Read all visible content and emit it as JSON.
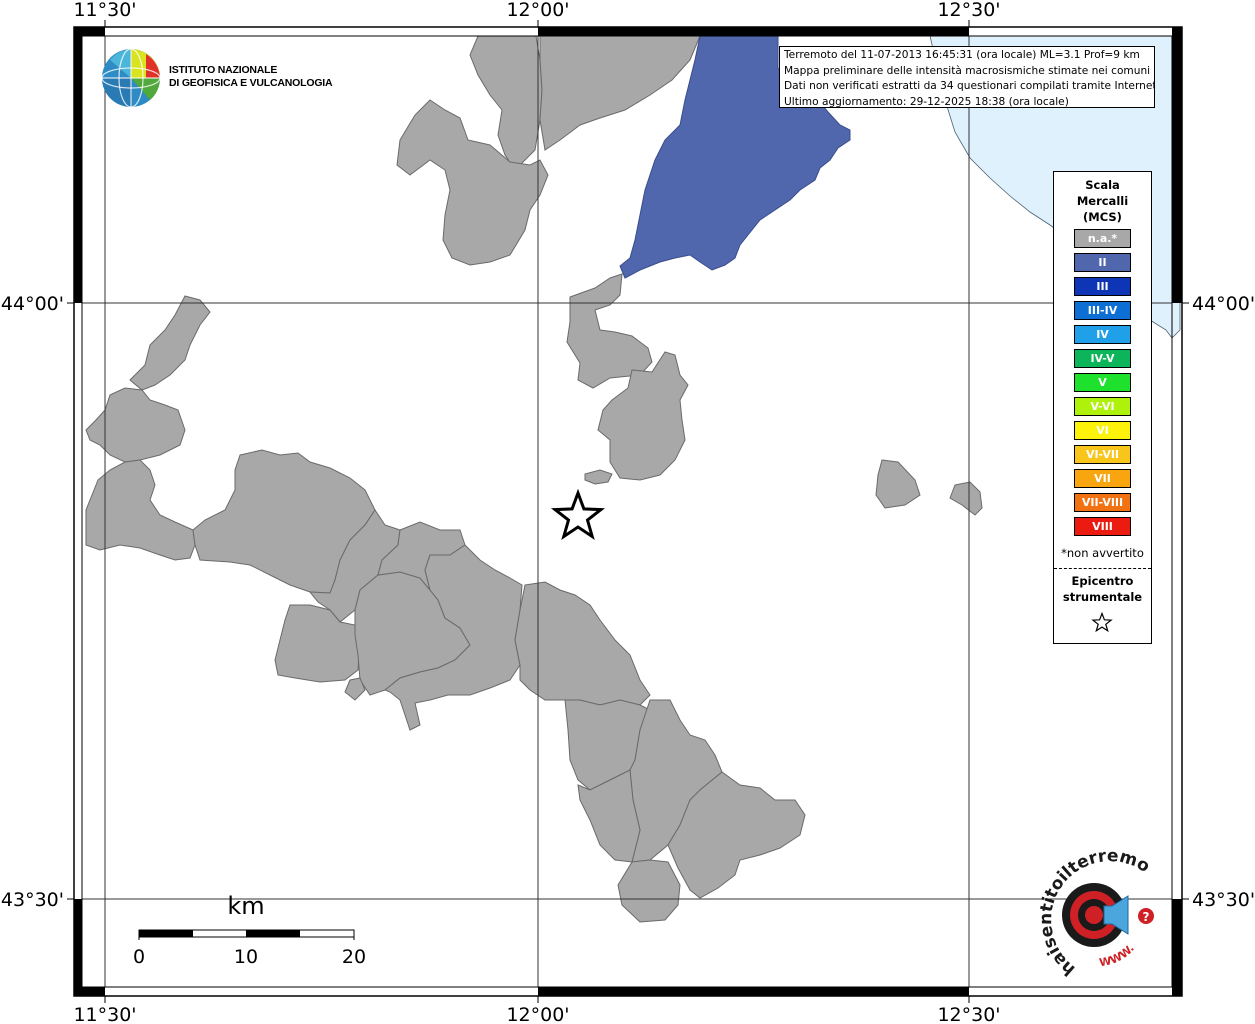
{
  "map": {
    "coord_labels": {
      "top": [
        "11°30'",
        "12°00'",
        "12°30'"
      ],
      "bottom": [
        "11°30'",
        "12°00'",
        "12°30'"
      ],
      "left": [
        "44°00'",
        "43°30'"
      ],
      "right": [
        "44°00'",
        "43°30'"
      ]
    },
    "scale_bar": {
      "unit": "km",
      "ticks": [
        "0",
        "10",
        "20"
      ]
    },
    "colors": {
      "land_na": "#a8a8a8",
      "intensity_II": "#5067ad",
      "sea": "#dff1fc",
      "outline": "#6a6a6a",
      "frame": "#000000"
    }
  },
  "logo": {
    "org_line1": "ISTITUTO NAZIONALE",
    "org_line2": "DI GEOFISICA E VULCANOLOGIA",
    "icon": "ingv-globe-icon"
  },
  "info": {
    "line1": "Terremoto del 11-07-2013 16:45:31 (ora locale) ML=3.1 Prof=9 km",
    "line2": "Mappa preliminare delle intensità macrosismiche stimate nei comuni",
    "line3": "Dati non verificati estratti da 34 questionari compilati tramite Internet.",
    "line4": "Ultimo aggiornamento: 29-12-2025 18:38 (ora locale)"
  },
  "legend": {
    "title_line1": "Scala",
    "title_line2": "Mercalli",
    "title_line3": "(MCS)",
    "items": [
      {
        "label": "n.a.*",
        "color": "#a8a8a8"
      },
      {
        "label": "II",
        "color": "#5067ad"
      },
      {
        "label": "III",
        "color": "#0d35b5"
      },
      {
        "label": "III-IV",
        "color": "#0d6fd3"
      },
      {
        "label": "IV",
        "color": "#1fa0e9"
      },
      {
        "label": "IV-V",
        "color": "#0cb45a"
      },
      {
        "label": "V",
        "color": "#1ee12e"
      },
      {
        "label": "V-VI",
        "color": "#aef20b"
      },
      {
        "label": "VI",
        "color": "#fcf20a"
      },
      {
        "label": "VI-VII",
        "color": "#f8c51a"
      },
      {
        "label": "VII",
        "color": "#f8a510"
      },
      {
        "label": "VII-VIII",
        "color": "#f27212"
      },
      {
        "label": "VIII",
        "color": "#eb1b12"
      }
    ],
    "note": "*non avvertito",
    "epicenter_line1": "Epicentro",
    "epicenter_line2": "strumentale",
    "epicenter_icon": "star-icon"
  },
  "hsit_logo": {
    "text": "haisentitoilterremoto.it",
    "www": "WWW.",
    "icon": "speaker-icon"
  }
}
